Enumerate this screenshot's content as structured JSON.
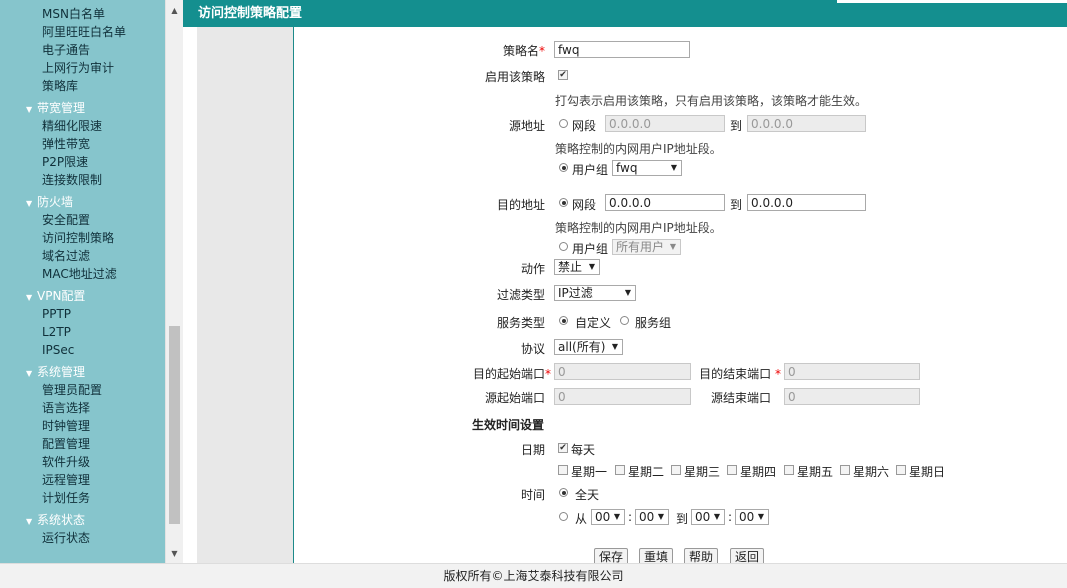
{
  "sidebar": {
    "items": [
      {
        "type": "sub",
        "label": "MSN白名单"
      },
      {
        "type": "sub",
        "label": "阿里旺旺白名单"
      },
      {
        "type": "sub",
        "label": "电子通告"
      },
      {
        "type": "sub",
        "label": "上网行为审计"
      },
      {
        "type": "sub",
        "label": "策略库"
      },
      {
        "type": "group",
        "label": "带宽管理"
      },
      {
        "type": "sub",
        "label": "精细化限速"
      },
      {
        "type": "sub",
        "label": "弹性带宽"
      },
      {
        "type": "sub",
        "label": "P2P限速"
      },
      {
        "type": "sub",
        "label": "连接数限制"
      },
      {
        "type": "group",
        "label": "防火墙"
      },
      {
        "type": "sub",
        "label": "安全配置"
      },
      {
        "type": "sub",
        "label": "访问控制策略"
      },
      {
        "type": "sub",
        "label": "域名过滤"
      },
      {
        "type": "sub",
        "label": "MAC地址过滤"
      },
      {
        "type": "group",
        "label": "VPN配置"
      },
      {
        "type": "sub",
        "label": "PPTP"
      },
      {
        "type": "sub",
        "label": "L2TP"
      },
      {
        "type": "sub",
        "label": "IPSec"
      },
      {
        "type": "group",
        "label": "系统管理"
      },
      {
        "type": "sub",
        "label": "管理员配置"
      },
      {
        "type": "sub",
        "label": "语言选择"
      },
      {
        "type": "sub",
        "label": "时钟管理"
      },
      {
        "type": "sub",
        "label": "配置管理"
      },
      {
        "type": "sub",
        "label": "软件升级"
      },
      {
        "type": "sub",
        "label": "远程管理"
      },
      {
        "type": "sub",
        "label": "计划任务"
      },
      {
        "type": "group",
        "label": "系统状态"
      },
      {
        "type": "sub",
        "label": "运行状态"
      }
    ]
  },
  "header": {
    "title": "访问控制策略配置"
  },
  "form": {
    "policy_name": {
      "label": "策略名",
      "required": "*",
      "value": "fwq"
    },
    "enable": {
      "label": "启用该策略",
      "checkmark": "✔",
      "hint": "打勾表示启用该策略，只有启用该策略，该策略才能生效。"
    },
    "source": {
      "label": "源地址",
      "segment_label": "网段",
      "from": "0.0.0.0",
      "to_label": "到",
      "to": "0.0.0.0",
      "hint": "策略控制的内网用户IP地址段。",
      "group_label": "用户组",
      "group_value": "fwq"
    },
    "destination": {
      "label": "目的地址",
      "segment_label": "网段",
      "from": "0.0.0.0",
      "to_label": "到",
      "to": "0.0.0.0",
      "hint": "策略控制的内网用户IP地址段。",
      "group_label": "用户组",
      "group_value": "所有用户"
    },
    "action": {
      "label": "动作",
      "value": "禁止"
    },
    "filter_type": {
      "label": "过滤类型",
      "value": "IP过滤"
    },
    "service_type": {
      "label": "服务类型",
      "custom": "自定义",
      "group": "服务组"
    },
    "protocol": {
      "label": "协议",
      "value": "all(所有)"
    },
    "dst_start_port": {
      "label": "目的起始端口",
      "required": "*",
      "value": "0"
    },
    "dst_end_port": {
      "label": "目的结束端口",
      "required": "*",
      "value": "0"
    },
    "src_start_port": {
      "label": "源起始端口",
      "value": "0"
    },
    "src_end_port": {
      "label": "源结束端口",
      "value": "0"
    },
    "schedule": {
      "section_title": "生效时间设置",
      "date_label": "日期",
      "every_day": "每天",
      "checkmark": "✔",
      "weekdays": [
        "星期一",
        "星期二",
        "星期三",
        "星期四",
        "星期五",
        "星期六",
        "星期日"
      ],
      "time_label": "时间",
      "all_day": "全天",
      "from_label": "从",
      "to_label": "到",
      "colon": ":",
      "h1": "00",
      "m1": "00",
      "h2": "00",
      "m2": "00"
    },
    "buttons": {
      "save": "保存",
      "refill": "重填",
      "help": "帮助",
      "back": "返回"
    }
  },
  "footer": {
    "copyright": "版权所有©上海艾泰科技有限公司"
  },
  "icons": {
    "dropdown": "▼",
    "scroll_up": "▲",
    "scroll_down": "▼",
    "group_expanded": "▼"
  },
  "colors": {
    "header": "#148f8f",
    "sidebar": "#86c5cc",
    "required": "#e00000"
  }
}
